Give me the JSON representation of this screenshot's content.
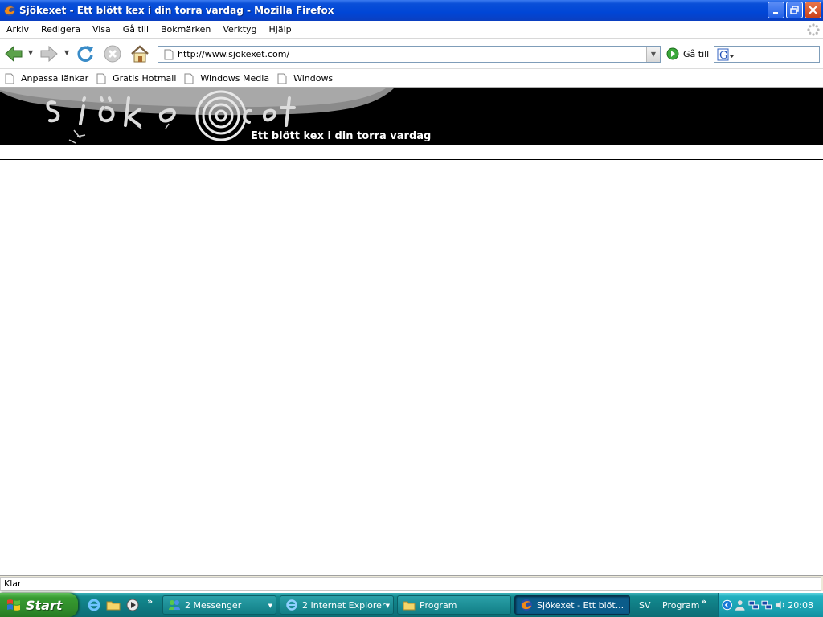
{
  "window": {
    "title": "Sjökexet - Ett blött kex i din torra vardag - Mozilla Firefox",
    "controls": [
      "minimize",
      "restore",
      "close"
    ]
  },
  "menubar": {
    "items": [
      "Arkiv",
      "Redigera",
      "Visa",
      "Gå till",
      "Bokmärken",
      "Verktyg",
      "Hjälp"
    ]
  },
  "navbar": {
    "buttons": [
      "back",
      "forward",
      "reload",
      "stop",
      "home"
    ],
    "url": "http://www.sjokexet.com/",
    "go_label": "Gå till",
    "search_placeholder": ""
  },
  "bookmarks": {
    "items": [
      "Anpassa länkar",
      "Gratis Hotmail",
      "Windows Media",
      "Windows"
    ]
  },
  "page": {
    "banner_slogan": "Ett blött kex i din torra vardag",
    "banner_logo_text": "sjökexet"
  },
  "statusbar": {
    "text": "Klar"
  },
  "taskbar": {
    "start_label": "Start",
    "tasks": [
      {
        "label": "2 Messenger",
        "icon": "messenger-icon",
        "active": false
      },
      {
        "label": "2 Internet Explorer",
        "icon": "ie-icon",
        "active": false
      },
      {
        "label": "Program",
        "icon": "folder-icon",
        "active": false
      },
      {
        "label": "Sjökexet - Ett blöt...",
        "icon": "firefox-icon",
        "active": true
      }
    ],
    "language": "SV",
    "toolbar_label": "Program",
    "clock": "20:08"
  },
  "colors": {
    "titlebar": "#0046d6",
    "taskbar": "#0f7a82",
    "start_button": "#379b31",
    "banner_bg": "#000000"
  }
}
